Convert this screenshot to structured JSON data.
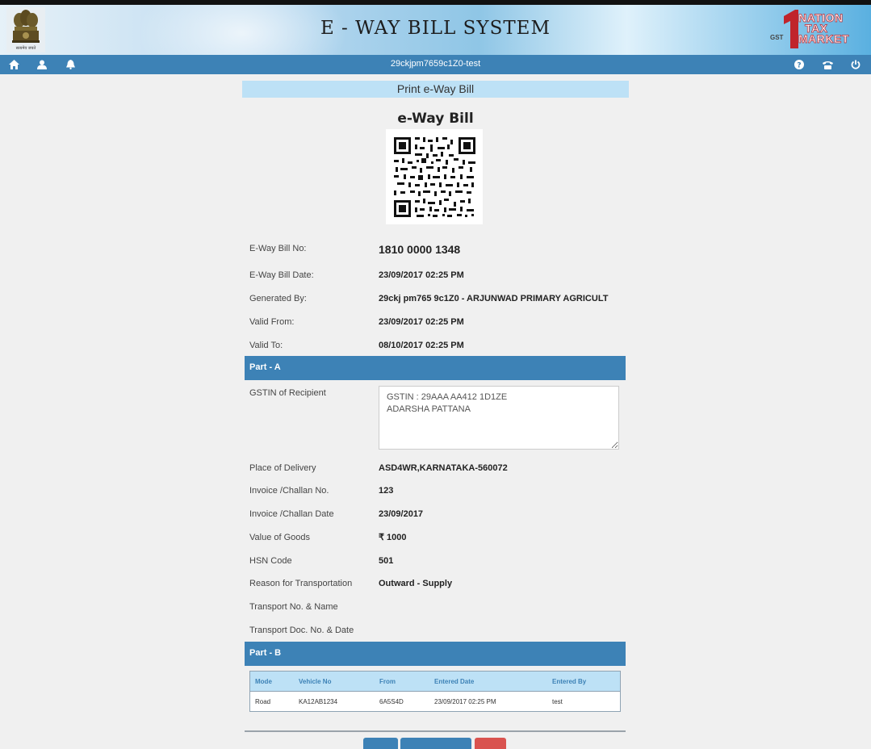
{
  "header": {
    "title": "E - WAY BILL SYSTEM",
    "emblem_caption": "सत्यमेव जयते",
    "logo_badge": "GST",
    "logo_lines": [
      "NATION",
      "TAX",
      "MARKET"
    ]
  },
  "navbar": {
    "user_id": "29ckjpm7659c1Z0-test",
    "left_icons": [
      "home-icon",
      "user-icon",
      "bell-icon"
    ],
    "right_icons": [
      "help-icon",
      "phone-icon",
      "power-icon"
    ]
  },
  "panel": {
    "print_title": "Print e-Way Bill",
    "heading": "e-Way Bill",
    "details": [
      {
        "label": "E-Way Bill No:",
        "value": "1810 0000 1348"
      },
      {
        "label": "E-Way Bill Date:",
        "value": "23/09/2017 02:25 PM"
      },
      {
        "label": "Generated By:",
        "value": "29ckj pm765 9c1Z0 - ARJUNWAD PRIMARY AGRICULT"
      },
      {
        "label": "Valid From:",
        "value": "23/09/2017 02:25 PM"
      },
      {
        "label": "Valid To:",
        "value": "08/10/2017 02:25 PM"
      }
    ],
    "part_a": {
      "title": "Part - A",
      "gstin_label": "GSTIN of Recipient",
      "gstin_value": "GSTIN : 29AAA  AA412  1D1ZE\nADARSHA PATTANA",
      "rows": [
        {
          "label": "Place of Delivery",
          "value": "ASD4WR,KARNATAKA-560072"
        },
        {
          "label": "Invoice /Challan No.",
          "value": "123"
        },
        {
          "label": "Invoice /Challan Date",
          "value": "23/09/2017"
        },
        {
          "label": "Value of Goods",
          "value": "₹ 1000"
        },
        {
          "label": "HSN Code",
          "value": "501"
        },
        {
          "label": "Reason for Transportation",
          "value": "Outward - Supply"
        },
        {
          "label": "Transport No. & Name",
          "value": ""
        },
        {
          "label": "Transport Doc. No. & Date",
          "value": ""
        }
      ]
    },
    "part_b": {
      "title": "Part - B",
      "columns": [
        "Mode",
        "Vehicle No",
        "From",
        "Entered Date",
        "Entered By"
      ],
      "rows": [
        [
          "Road",
          "KA12AB1234",
          "6A5S4D",
          "23/09/2017 02:25 PM",
          "test"
        ]
      ]
    }
  },
  "colors": {
    "nav_blue": "#3d82b6",
    "light_blue": "#bde1f6",
    "button_blue": "#3d82b6",
    "button_red": "#d9534f"
  }
}
